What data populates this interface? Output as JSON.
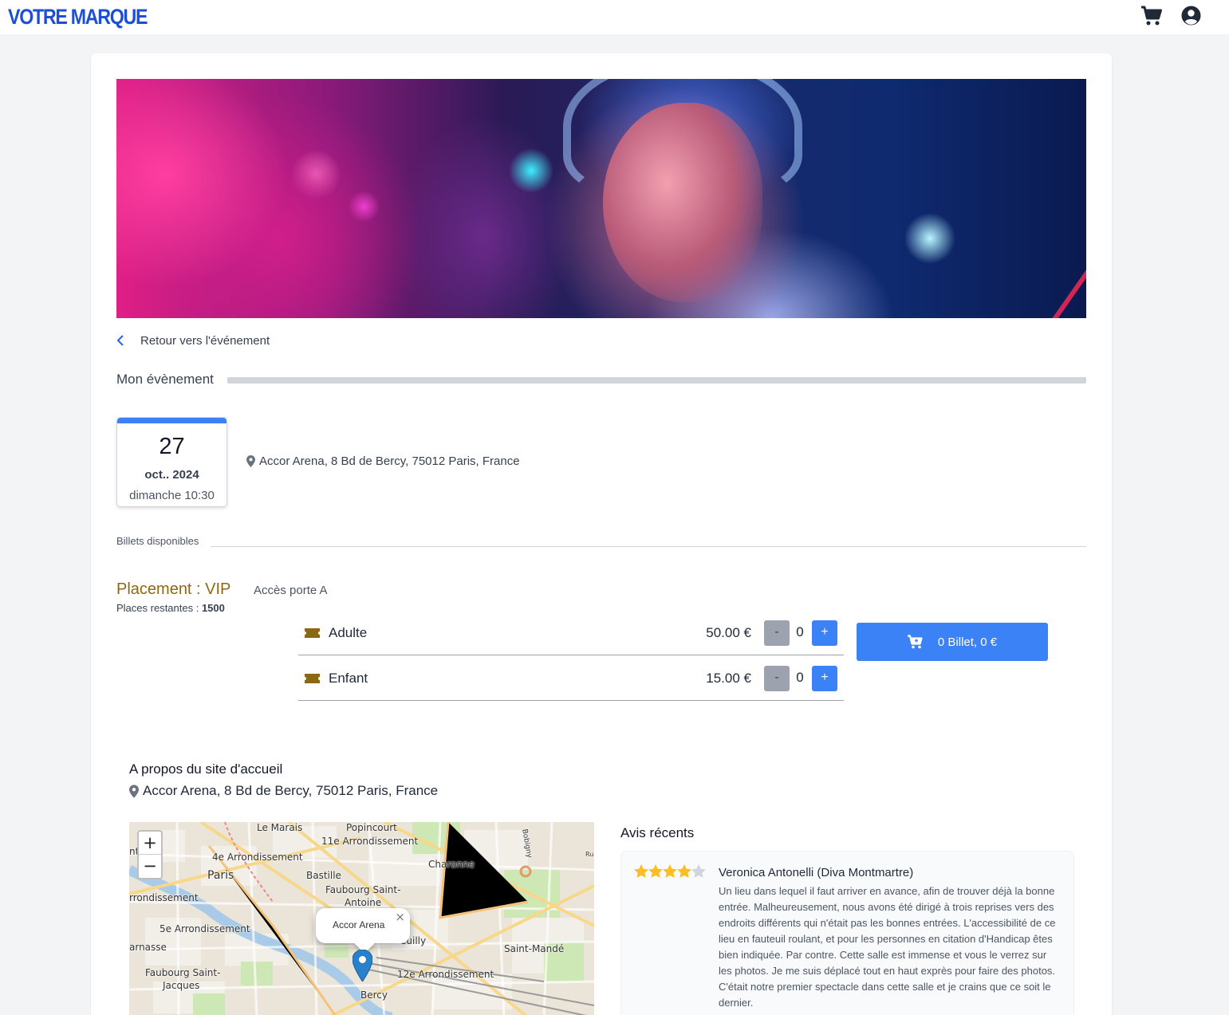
{
  "header": {
    "brand": "VOTRE MARQUE",
    "cart_icon": "cart-icon",
    "user_icon": "user-circle-icon"
  },
  "back": {
    "label": "Retour vers l'événement"
  },
  "event": {
    "section_title": "Mon évènement",
    "date": {
      "day": "27",
      "month_year": "oct.. 2024",
      "weekday_time": "dimanche 10:30"
    },
    "address": "Accor Arena, 8 Bd de Bercy, 75012 Paris, France"
  },
  "tickets": {
    "section_label": "Billets disponibles",
    "placement": "Placement : VIP",
    "access": "Accès porte A",
    "places_label": "Places restantes : ",
    "places_value": "1500",
    "items": [
      {
        "name": "Adulte",
        "price": "50.00 €",
        "qty": "0",
        "minus": "-",
        "plus": "+"
      },
      {
        "name": "Enfant",
        "price": "15.00 €",
        "qty": "0",
        "minus": "-",
        "plus": "+"
      }
    ],
    "cart_button": "0 Billet, 0 €"
  },
  "venue": {
    "title": "A propos du site d'accueil",
    "address": "Accor Arena, 8 Bd de Bercy, 75012 Paris, France",
    "map": {
      "zoom_in": "+",
      "zoom_out": "−",
      "popup": "Accor Arena",
      "popup_close": "×",
      "labels": [
        "Le Marais",
        "Popincourt",
        "11e Arrondissement",
        "4e Arrondissement",
        "Paris",
        "Bastille",
        "Charonne",
        "Faubourg Saint-",
        "Antoine",
        "rrondissement",
        "5e Arrondissement",
        "arnasse",
        "euilly",
        "Saint-Mandé",
        "Faubourg Saint-",
        "Jacques",
        "12e Arrondissement",
        "Bercy",
        "Bobigny",
        "nt",
        "Ru"
      ]
    }
  },
  "reviews": {
    "title": "Avis récents",
    "items": [
      {
        "rating": 4,
        "max": 5,
        "author": "Veronica Antonelli (Diva Montmartre)",
        "text": "Un lieu dans lequel il faut arriver en avance, afin de trouver déjà la bonne entrée. Malheureusement, nous avons été dirigé à trois reprises vers des endroits différents qui n'était pas les bonnes entrées. L'accessibilité de ce lieu en fauteuil roulant, et pour les personnes en citation d'Handicap êtes bien indiquée. Par contre. Cette salle est immense et vous le verrez sur les photos. Je me suis déplacé tout en haut exprès pour faire des photos. C'était notre premier spectacle dans cette salle et je crains que ce soit le dernier."
      }
    ]
  },
  "colors": {
    "accent": "#3b82f6",
    "brand": "#1d4ed8",
    "placement": "#8b6914",
    "star": "#fbbf24",
    "star_empty": "#d1d5db"
  }
}
